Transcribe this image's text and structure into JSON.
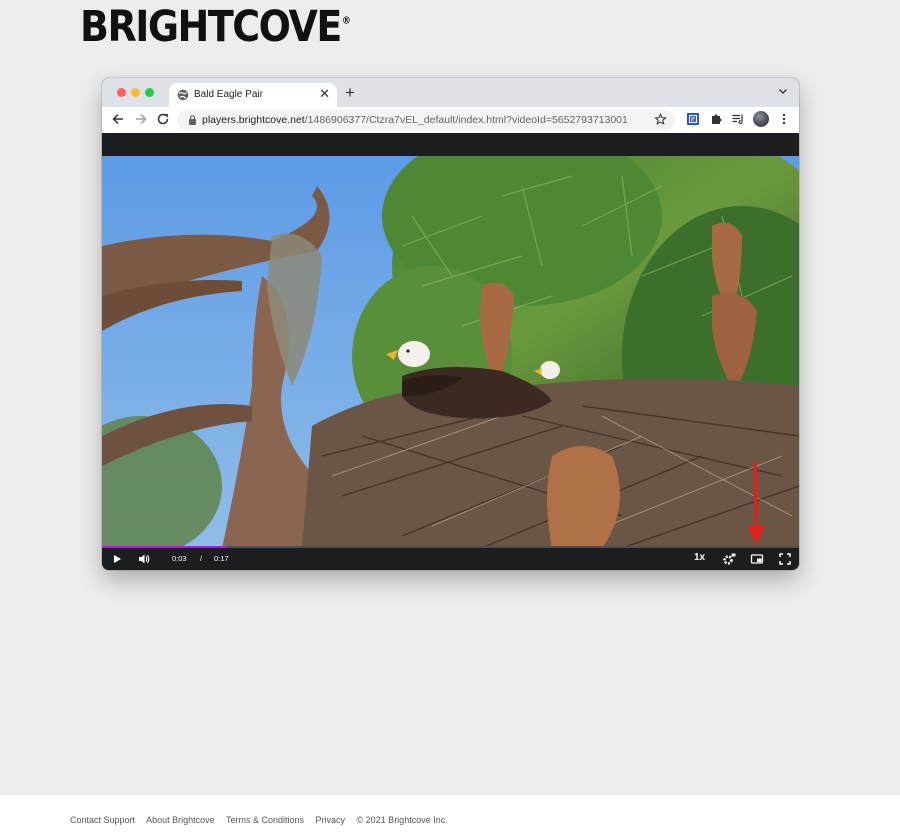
{
  "brand": {
    "logo_text": "BRIGHTCOVE",
    "registered_mark": "®"
  },
  "browser": {
    "tab": {
      "title": "Bald Eagle Pair",
      "close": "✕"
    },
    "new_tab": "+",
    "address_bar": {
      "url_host": "players.brightcove.net",
      "url_path": "/1486906377/Ctzra7vEL_default/index.html?videoId=5652793713001"
    }
  },
  "player": {
    "current_time": "0:03",
    "separator": "/",
    "duration": "0:17",
    "playback_rate": "1x",
    "progress_fraction": 0.18,
    "accent_color": "#b517e2"
  },
  "footer": {
    "links": [
      "Contact Support",
      "About Brightcove",
      "Terms & Conditions",
      "Privacy"
    ],
    "copyright": "© 2021 Brightcove Inc."
  }
}
